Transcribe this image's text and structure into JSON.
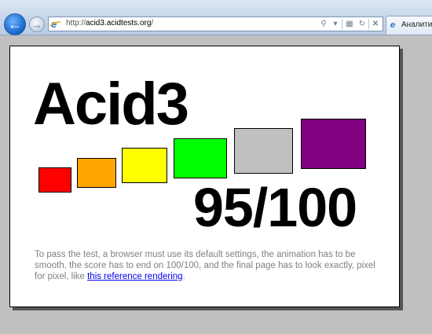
{
  "browser": {
    "url_prefix": "http://",
    "url_domain": "acid3.acidtests.org",
    "url_suffix": "/",
    "tab_label": "Аналити",
    "icons": {
      "back": "back-arrow-icon",
      "forward": "forward-arrow-icon",
      "search": "search-icon",
      "dropdown": "chevron-down-icon",
      "compat": "compatibility-view-icon",
      "refresh": "refresh-icon",
      "stop": "close-icon"
    }
  },
  "page": {
    "title": "Acid3",
    "score": "95/100",
    "description_before_link": "To pass the test, a browser must use its default settings, the animation has to be smooth, the score has to end on 100/100, and the final page has to look exactly, pixel for pixel, like ",
    "link_text": "this reference rendering",
    "description_after_link": ".",
    "boxes": [
      {
        "name": "box-red",
        "color": "#ff0000"
      },
      {
        "name": "box-orange",
        "color": "#ffa500"
      },
      {
        "name": "box-yellow",
        "color": "#ffff00"
      },
      {
        "name": "box-lime",
        "color": "#00ff00"
      },
      {
        "name": "box-silver",
        "color": "#c0c0c0"
      },
      {
        "name": "box-purple",
        "color": "#800080"
      }
    ]
  }
}
